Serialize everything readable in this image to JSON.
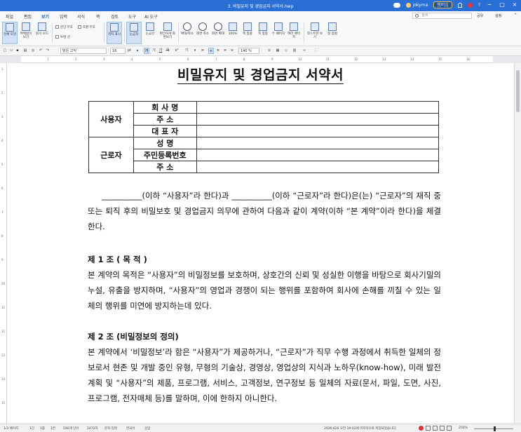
{
  "window": {
    "title": "3. 비밀유지 및 경업금지 서약서.hwp",
    "user": "jokyma",
    "membership": "멤버십",
    "minimize": "−",
    "maximize": "□",
    "close": "×"
  },
  "menu": {
    "items": [
      "파일",
      "편집",
      "보기",
      "입력",
      "서식",
      "쪽",
      "검토",
      "도구",
      "AI 도구"
    ],
    "active": "보기",
    "search_placeholder": "검색",
    "share": "공유",
    "settings": "설정"
  },
  "ribbon": {
    "buttons": [
      {
        "label": "전체 모양",
        "selected": true
      },
      {
        "label": "여백없이 보기",
        "selected": false
      },
      {
        "label": "읽기 모드",
        "selected": false
      },
      {
        "label": "격자 표시",
        "selected": true
      },
      {
        "label": "눈금자",
        "selected": true
      },
      {
        "label": "눈금선",
        "selected": false
      },
      {
        "label": "편안하게 화면보기",
        "selected": false
      },
      {
        "label": "확대/축소",
        "selected": false
      },
      {
        "label": "화면 축소",
        "selected": false
      },
      {
        "label": "화면 확대",
        "selected": false
      },
      {
        "label": "100%",
        "selected": false
      },
      {
        "label": "폭 맞춤",
        "selected": false
      },
      {
        "label": "쪽 맞춤",
        "selected": false
      },
      {
        "label": "두 페이지",
        "selected": false
      },
      {
        "label": "여러 페이지",
        "selected": false
      },
      {
        "label": "작스트한 보기",
        "selected": false
      },
      {
        "label": "창 정렬",
        "selected": false
      }
    ],
    "checks": [
      {
        "label": "문단 부호",
        "checked": false
      },
      {
        "label": "조판 부호",
        "checked": false
      },
      {
        "label": "투명 선",
        "checked": false
      }
    ]
  },
  "format": {
    "style": "바탕글",
    "font": "맑은 고딕",
    "size": "16",
    "size_unit": "pt",
    "zoom": "140 %"
  },
  "ruler": {
    "h_ticks": [
      "1",
      "2",
      "3",
      "4",
      "5",
      "6",
      "7",
      "8",
      "9",
      "10",
      "11",
      "12",
      "13",
      "14",
      "15",
      "16"
    ],
    "v_ticks": [
      "1",
      "2",
      "3",
      "4",
      "5",
      "6",
      "7",
      "8",
      "9",
      "10",
      "11",
      "12",
      "13",
      "14",
      "15"
    ]
  },
  "document": {
    "heading": "비밀유지 및 경업금지 서약서",
    "table": {
      "group1": "사용자",
      "group1_fields": [
        "회 사 명",
        "주      소",
        "대 표 자"
      ],
      "group2": "근로자",
      "group2_fields": [
        "성      명",
        "주민등록번호",
        "주      소"
      ]
    },
    "intro": "__________(이하 “사용자”라 한다)과 __________(이하 “근로자”라 한다)은(는) “근로자”의 재직 중 또는 퇴직 후의 비밀보호 및 경업금지 의무에 관하여 다음과 같이 계약(이하 “본 계약”이라 한다)을 체결한다.",
    "article1_title": "제 1 조 ( 목 적 )",
    "article1_body": "본 계약의 목적은 “사용자”의 비밀정보를 보호하며, 상호간의 신뢰 및 성실한 이행을 바탕으로 회사기밀의 누설, 유출을 방지하며, “사용자”의 영업과 경쟁이 되는 행위를 포함하여 회사에 손해를 끼칠 수 있는 일체의 행위를 미연에 방지하는데 있다.",
    "article2_title": "제 2 조 (비밀정보의 정의)",
    "article2_body": "본 계약에서 ‘비밀정보’라 함은 “사용자”가 제공하거나, “근로자”가 직무 수행 과정에서 취득한 일체의 정보로서 현존 및 개발 중인 유형, 무형의 기술상, 경영상, 영업상의 지식과 노하우(know-how), 미래 발전 계획 및 “사용자”의 제품, 프로그램, 서비스, 고객정보, 연구정보 등 일체의 자료(문서, 파일, 도면, 사진, 프로그램, 전자매체 등)를 말하며, 이에 한하지 아니한다."
  },
  "status": {
    "page": "1/3 페이지",
    "section": "1단",
    "line": "1줄",
    "col": "1칸",
    "words": "590개 단어",
    "chars": "2472자",
    "mode": "문자 입력",
    "lang": "한국어",
    "insert": "삽입",
    "saved": "2026.626 오전 10:02에 마지막으로 저장되었습니다.",
    "zoom": "200%"
  }
}
